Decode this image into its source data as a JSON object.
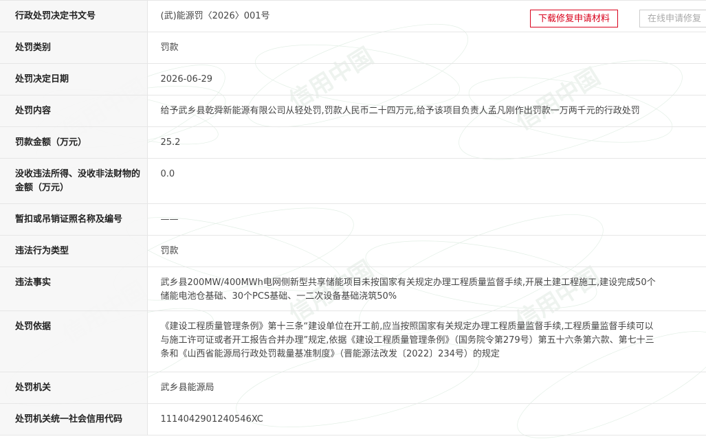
{
  "record": {
    "rows": [
      {
        "label": "行政处罚决定书文号",
        "value": "(武)能源罚〈2026〉001号"
      },
      {
        "label": "处罚类别",
        "value": "罚款"
      },
      {
        "label": "处罚决定日期",
        "value": "2026-06-29"
      },
      {
        "label": "处罚内容",
        "value": "给予武乡县乾舜新能源有限公司从轻处罚,罚款人民币二十四万元,给予该项目负责人孟凡刚作出罚款一万两千元的行政处罚"
      },
      {
        "label": "罚款金额（万元）",
        "value": "25.2"
      },
      {
        "label": "没收违法所得、没收非法财物的金额（万元）",
        "value": "0.0"
      },
      {
        "label": "暂扣或吊销证照名称及编号",
        "value": "——"
      },
      {
        "label": "违法行为类型",
        "value": "罚款"
      },
      {
        "label": "违法事实",
        "lines": [
          "武乡县200MW/400MWh电网侧新型共享储能项目未按国家有关规定办理工程质量监督手续,开展土建工程施工,建设完成50个",
          "储能电池仓基础、30个PCS基础、一二次设备基础浇筑50%"
        ]
      },
      {
        "label": "处罚依据",
        "lines": [
          "《建设工程质量管理条例》第十三条“建设单位在开工前,应当按照国家有关规定办理工程质量监督手续,工程质量监督手续可以",
          "与施工许可证或者开工报告合并办理”规定,依据《建设工程质量管理条例》（国务院令第279号）第五十六条第六款、第七十三",
          "条和《山西省能源局行政处罚裁量基准制度》（晋能源法改发〔2022〕234号）的规定"
        ]
      },
      {
        "label": "处罚机关",
        "value": "武乡县能源局"
      },
      {
        "label": "处罚机关统一社会信用代码",
        "value": "1114042901240546XC"
      }
    ]
  },
  "actions": {
    "download_label": "下载修复申请材料",
    "online_label": "在线申请修复"
  },
  "watermark": {
    "text": "信用中国"
  },
  "colors": {
    "accent": "#d9001b",
    "label_bg": "#f6f6f6",
    "border": "#e6e6e6"
  }
}
